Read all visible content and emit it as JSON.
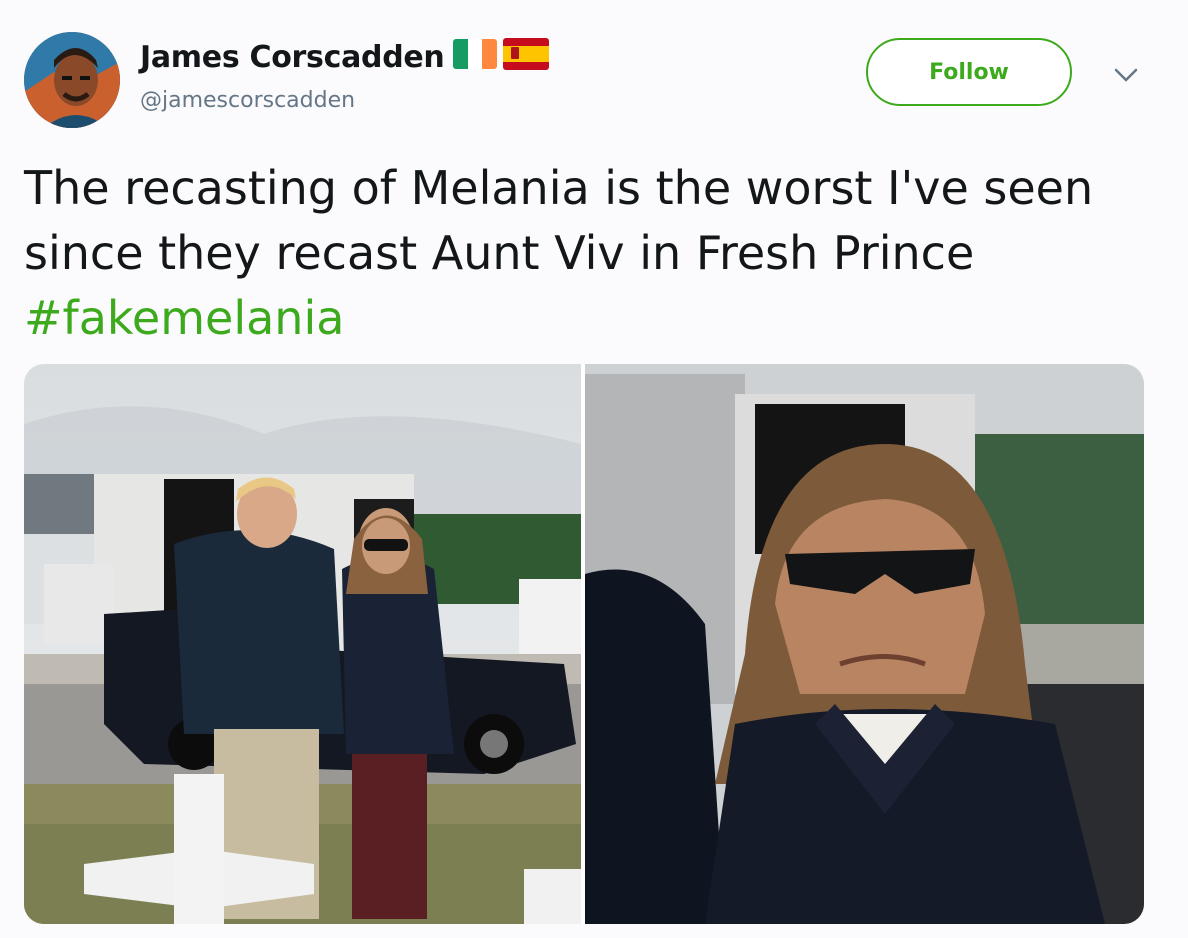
{
  "tweet": {
    "author_name": "James Corscadden",
    "author_handle": "@jamescorscadden",
    "flags": [
      "ireland-flag",
      "spain-flag"
    ],
    "follow_label": "Follow",
    "text_line1": "The recasting of Melania is the worst I've seen",
    "text_line2": "since they recast Aunt Viv in Fresh Prince",
    "hashtag": "#fakemelania",
    "accent_color": "#3daa1e",
    "media": [
      {
        "name": "photo-couple-at-memorial"
      },
      {
        "name": "photo-closeup-sunglasses"
      }
    ]
  }
}
